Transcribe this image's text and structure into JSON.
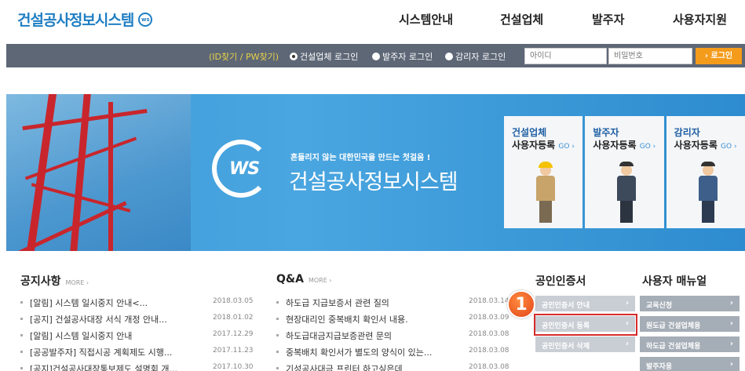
{
  "header": {
    "logo": "건설공사정보시스템",
    "logo_badge": "ws",
    "nav": [
      "시스템안내",
      "건설업체",
      "발주자",
      "사용자지원"
    ]
  },
  "login": {
    "find_link": "(ID찾기 / PW찾기)",
    "radios": [
      {
        "label": "건설업체 로그인",
        "selected": true
      },
      {
        "label": "발주자 로그인",
        "selected": false
      },
      {
        "label": "감리자 로그인",
        "selected": false
      }
    ],
    "id_placeholder": "아이디",
    "pw_placeholder": "비밀번호",
    "login_button": "› 로그인"
  },
  "banner": {
    "slogan": "흔들리지 않는 대한민국을 만드는 첫걸음 !",
    "ws": "WS",
    "title": "건설공사정보시스템",
    "cards": [
      {
        "t1": "건설업체",
        "t2": "사용자등록",
        "go": "GO ›"
      },
      {
        "t1": "발주자",
        "t2": "사용자등록",
        "go": "GO ›"
      },
      {
        "t1": "감리자",
        "t2": "사용자등록",
        "go": "GO ›"
      }
    ]
  },
  "notice": {
    "title": "공지사항",
    "more": "MORE ›",
    "items": [
      {
        "text": "[알림] 시스템 일시중지 안내<...",
        "date": "2018.03.05"
      },
      {
        "text": "[공지] 건설공사대장 서식 개정 안내...",
        "date": "2018.01.02"
      },
      {
        "text": "[알림] 시스템 일시중지 안내",
        "date": "2017.12.29"
      },
      {
        "text": "[공공발주자] 직접시공 계획제도 시행...",
        "date": "2017.11.23"
      },
      {
        "text": "[공지]건설공사대장통보제도 설명회 개...",
        "date": "2017.10.30"
      }
    ]
  },
  "qna": {
    "title": "Q&A",
    "more": "MORE ›",
    "items": [
      {
        "text": "하도급 지급보증서 관련 질의",
        "date": "2018.03.14"
      },
      {
        "text": "현장대리인 중복배치 확인서 내용.",
        "date": "2018.03.09"
      },
      {
        "text": "하도급대금지급보증관련 문의",
        "date": "2018.03.08"
      },
      {
        "text": "중복배치 확인서가 별도의 양식이 있는...",
        "date": "2018.03.08"
      },
      {
        "text": "기성공사대금 프린터 하고싶은데",
        "date": "2018.03.08"
      }
    ]
  },
  "cert": {
    "title": "공인인증서",
    "items": [
      "공인인증서 안내",
      "공인인증서 등록",
      "공인인증서 삭제"
    ]
  },
  "manual": {
    "title": "사용자 매뉴얼",
    "items": [
      "교육신청",
      "원도급 건설업체용",
      "하도급 건설업체용",
      "발주자용"
    ]
  },
  "step_badge": "1",
  "colors": {
    "brand": "#1f7ec3",
    "loginbar": "#5d6776",
    "accent": "#f49b1b",
    "highlight": "#d62b2b"
  }
}
